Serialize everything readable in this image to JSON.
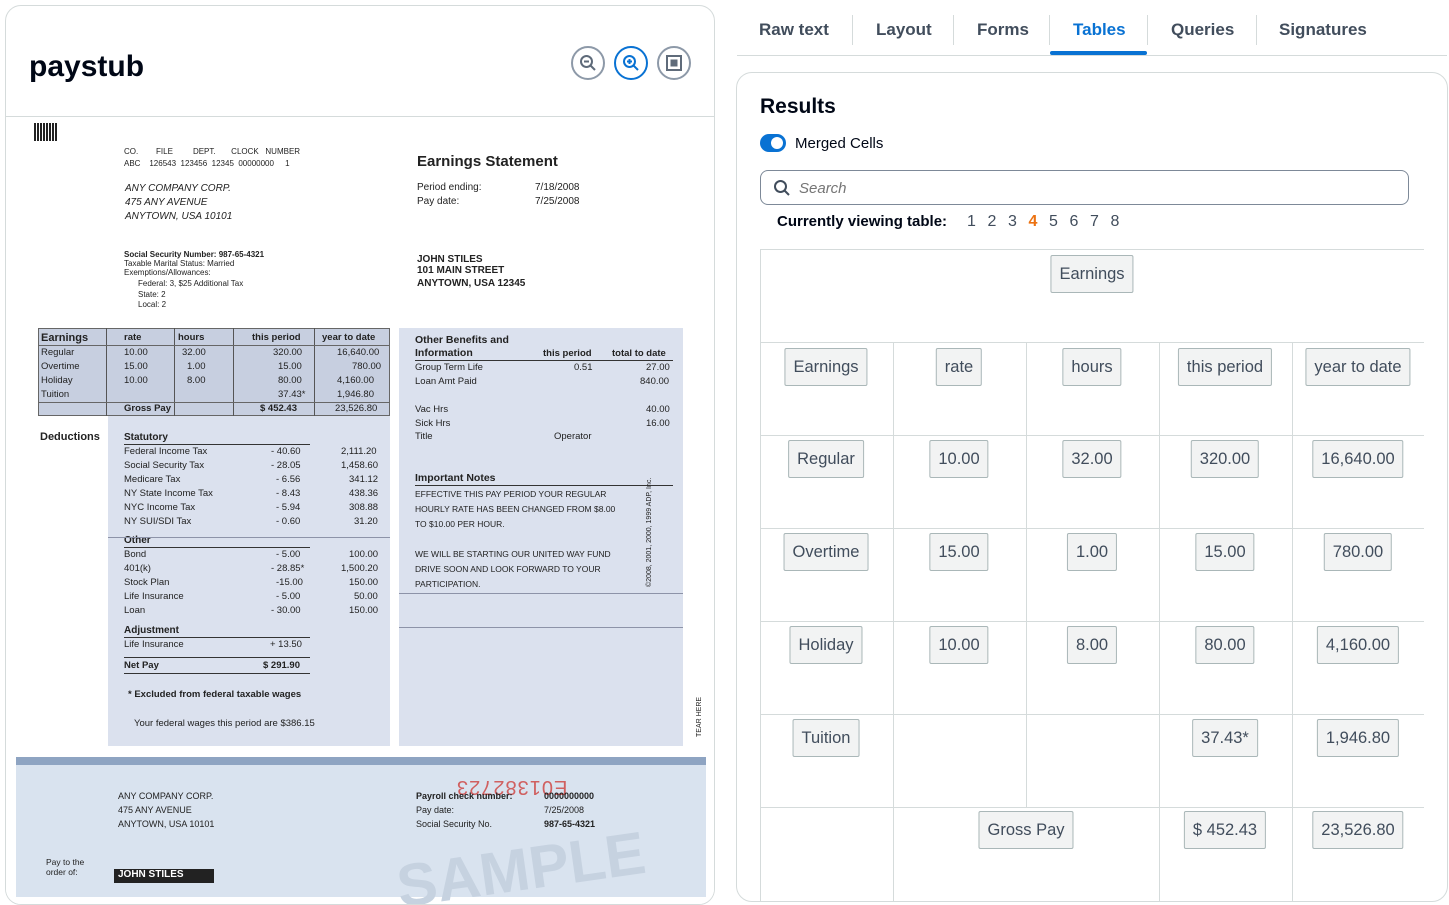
{
  "document": {
    "title": "paystub",
    "zoom_out_icon": "zoom-out-icon",
    "zoom_in_icon": "zoom-in-icon",
    "fit_icon": "fit-page-icon",
    "paystub": {
      "codes_header": [
        "CO.",
        "FILE",
        "DEPT.",
        "CLOCK",
        "NUMBER"
      ],
      "codes_values": [
        "ABC",
        "126543",
        "123456",
        "12345",
        "00000000",
        "1"
      ],
      "company": [
        "ANY COMPANY CORP.",
        "475 ANY AVENUE",
        "ANYTOWN, USA 10101"
      ],
      "statement_title": "Earnings Statement",
      "period_ending_label": "Period ending:",
      "period_ending_value": "7/18/2008",
      "pay_date_label": "Pay date:",
      "pay_date_value": "7/25/2008",
      "ssn_line": "Social Security Number: 987-65-4321",
      "marital": "Taxable Marital Status: Married",
      "exemptions": "Exemptions/Allowances:",
      "federal": "Federal:  3, $25  Additional  Tax",
      "state": "State:    2",
      "local": "Local:    2",
      "employee": [
        "JOHN STILES",
        "101 MAIN STREET",
        "ANYTOWN, USA 12345"
      ],
      "earnings_headers": [
        "Earnings",
        "rate",
        "hours",
        "this period",
        "year to date"
      ],
      "earnings_rows": [
        [
          "Regular",
          "10.00",
          "32.00",
          "320.00",
          "16,640.00"
        ],
        [
          "Overtime",
          "15.00",
          "1.00",
          "15.00",
          "780.00"
        ],
        [
          "Holiday",
          "10.00",
          "8.00",
          "80.00",
          "4,160.00"
        ],
        [
          "Tuition",
          "",
          "",
          "37.43*",
          "1,946.80"
        ]
      ],
      "gross_pay_label": "Gross Pay",
      "gross_pay_value": "$ 452.43",
      "gross_pay_ytd": "23,526.80",
      "deductions_label": "Deductions",
      "statutory_label": "Statutory",
      "statutory_rows": [
        [
          "Federal Income Tax",
          "- 40.60",
          "2,111.20"
        ],
        [
          "Social Security Tax",
          "- 28.05",
          "1,458.60"
        ],
        [
          "Medicare Tax",
          "- 6.56",
          "341.12"
        ],
        [
          "NY State Income Tax",
          "- 8.43",
          "438.36"
        ],
        [
          "NYC Income Tax",
          "- 5.94",
          "308.88"
        ],
        [
          "NY SUI/SDI Tax",
          "- 0.60",
          "31.20"
        ]
      ],
      "other_label": "Other",
      "other_rows": [
        [
          "Bond",
          "- 5.00",
          "100.00"
        ],
        [
          "401(k)",
          "- 28.85*",
          "1,500.20"
        ],
        [
          "Stock Plan",
          "-15.00",
          "150.00"
        ],
        [
          "Life Insurance",
          "- 5.00",
          "50.00"
        ],
        [
          "Loan",
          "- 30.00",
          "150.00"
        ]
      ],
      "adjustment_label": "Adjustment",
      "adjustment_row": [
        "Life Insurance",
        "+ 13.50"
      ],
      "net_pay_label": "Net Pay",
      "net_pay_value": "$ 291.90",
      "excluded_note": "* Excluded  from  federal  taxable  wages",
      "federal_wages_note": "Your  federal  wages  this  period  are  $386.15",
      "benefits_title": "Other Benefits and",
      "benefits_title2": "Information",
      "benefits_this_period": "this period",
      "benefits_total": "total to date",
      "benefits_rows": [
        [
          "Group Term Life",
          "0.51",
          "27.00"
        ],
        [
          "Loan Amt Paid",
          "",
          "840.00"
        ]
      ],
      "vac_hrs": [
        "Vac  Hrs",
        "40.00"
      ],
      "sick_hrs": [
        "Sick  Hrs",
        "16.00"
      ],
      "title_row": [
        "Title",
        "Operator"
      ],
      "important_notes_title": "Important  Notes",
      "notes_1": [
        "EFFECTIVE THIS PAY PERIOD YOUR REGULAR",
        "HOURLY RATE HAS BEEN CHANGED FROM $8.00",
        "TO $10.00 PER HOUR."
      ],
      "notes_2": [
        "WE WILL BE STARTING OUR UNITED WAY FUND",
        "DRIVE SOON AND LOOK FORWARD TO YOUR",
        "PARTICIPATION."
      ],
      "copyright": "©2008, 2001, 2000, 1999 ADP, Inc.",
      "tear_here": "TEAR HERE"
    },
    "check": {
      "serial": "E01382723",
      "company": [
        "ANY COMPANY CORP.",
        "475  ANY  AVENUE",
        "ANYTOWN,  USA  10101"
      ],
      "payroll_label": "Payroll  check  number:",
      "payroll_value": "0000000000",
      "pay_date_label": "Pay  date:",
      "pay_date_value": "7/25/2008",
      "ssn_label": "Social  Security  No.",
      "ssn_value": "987-65-4321",
      "pay_to_label": "Pay  to  the",
      "order_label": "order of:",
      "payee": "JOHN  STILES",
      "watermark": "SAMPLE"
    }
  },
  "tabs": [
    "Raw text",
    "Layout",
    "Forms",
    "Tables",
    "Queries",
    "Signatures"
  ],
  "active_tab": "Tables",
  "results": {
    "title": "Results",
    "merged_cells_label": "Merged Cells",
    "merged_cells_on": true,
    "search_placeholder": "Search",
    "viewing_label": "Currently viewing table:",
    "pages": [
      "1",
      "2",
      "3",
      "4",
      "5",
      "6",
      "7",
      "8"
    ],
    "active_page": "4",
    "table": {
      "title_cell": "Earnings",
      "headers": [
        "Earnings",
        "rate",
        "hours",
        "this period",
        "year to date"
      ],
      "rows": [
        [
          "Regular",
          "10.00",
          "32.00",
          "320.00",
          "16,640.00"
        ],
        [
          "Overtime",
          "15.00",
          "1.00",
          "15.00",
          "780.00"
        ],
        [
          "Holiday",
          "10.00",
          "8.00",
          "80.00",
          "4,160.00"
        ],
        [
          "Tuition",
          "",
          "",
          "37.43*",
          "1,946.80"
        ]
      ],
      "gross_pay_label": "Gross Pay",
      "gross_pay_value": "$ 452.43",
      "gross_pay_ytd": "23,526.80"
    }
  },
  "colors": {
    "accent": "#0972d3",
    "active_page": "#ec7211",
    "doc_blue": "#dbe1ee"
  }
}
